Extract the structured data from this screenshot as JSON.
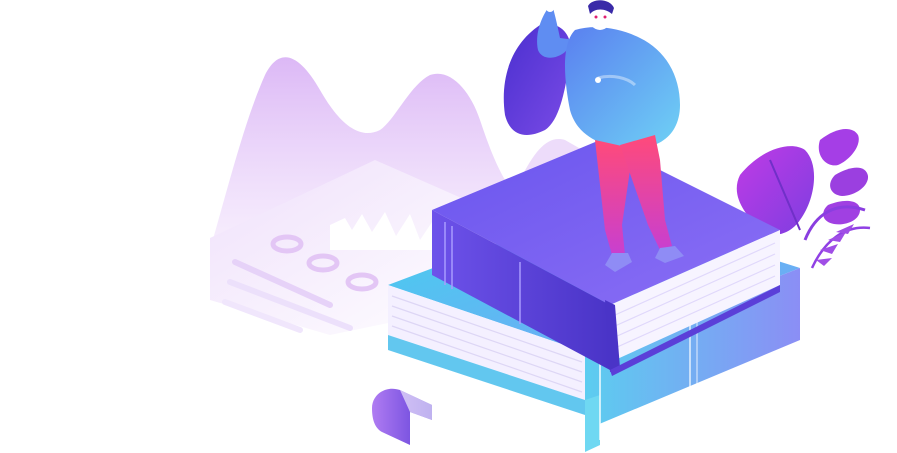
{
  "illustration": {
    "subject": "woman-standing-on-stacked-books",
    "colors": {
      "mountain": "#e3c6f5",
      "card": "#f3e8fc",
      "book_top_cover": "#7b5ef0",
      "book_top_side": "#5b3fd8",
      "book_bottom_cover": "#5fd3ee",
      "book_bottom_side": "#7aa6f5",
      "pages": "#f7f4ff",
      "shirt": "#6fa8f5",
      "pants": "#f0437f",
      "hair": "#5a3ad0",
      "leaves": "#9b3fe0",
      "skin": "#ffffff"
    }
  }
}
